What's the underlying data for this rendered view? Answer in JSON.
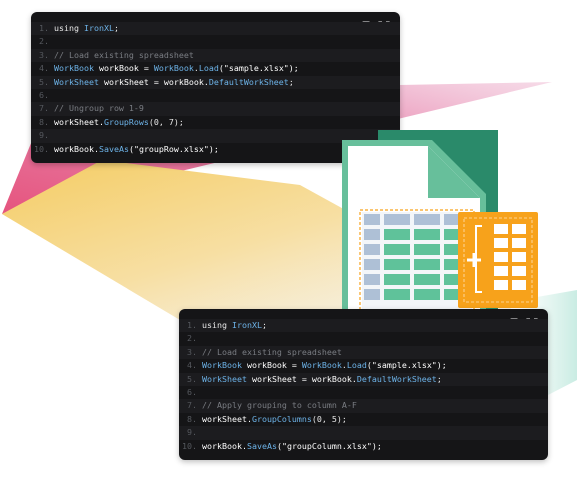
{
  "colors": {
    "pink": "#e5547e",
    "yellow": "#f4cc63",
    "sheet_green": "#5fb896",
    "sheet_dark": "#2a8a6a",
    "grid_blue": "#aec0d6",
    "grid_green": "#5fc29a",
    "orange": "#f7a21b"
  },
  "icons": {
    "copy": "copy-icon",
    "fullscreen": "fullscreen-icon",
    "add": "plus-icon"
  },
  "snippet_top": {
    "lines": [
      {
        "n": "1.",
        "alt": true,
        "tokens": [
          {
            "t": "using ",
            "c": "kw"
          },
          {
            "t": "IronXL",
            "c": "type"
          },
          {
            "t": ";",
            "c": "kw"
          }
        ]
      },
      {
        "n": "2.",
        "alt": false,
        "tokens": []
      },
      {
        "n": "3.",
        "alt": true,
        "tokens": [
          {
            "t": "// Load existing spreadsheet",
            "c": "com"
          }
        ]
      },
      {
        "n": "4.",
        "alt": false,
        "tokens": [
          {
            "t": "WorkBook",
            "c": "type"
          },
          {
            "t": " workBook = ",
            "c": "id"
          },
          {
            "t": "WorkBook",
            "c": "type"
          },
          {
            "t": ".",
            "c": "kw"
          },
          {
            "t": "Load",
            "c": "type"
          },
          {
            "t": "(\"sample.xlsx\");",
            "c": "str"
          }
        ]
      },
      {
        "n": "5.",
        "alt": true,
        "tokens": [
          {
            "t": "WorkSheet",
            "c": "type"
          },
          {
            "t": " workSheet = workBook.",
            "c": "id"
          },
          {
            "t": "DefaultWorkSheet",
            "c": "type"
          },
          {
            "t": ";",
            "c": "kw"
          }
        ]
      },
      {
        "n": "6.",
        "alt": false,
        "tokens": []
      },
      {
        "n": "7.",
        "alt": true,
        "tokens": [
          {
            "t": "// Ungroup row 1-9",
            "c": "com"
          }
        ]
      },
      {
        "n": "8.",
        "alt": false,
        "tokens": [
          {
            "t": "workSheet.",
            "c": "id"
          },
          {
            "t": "GroupRows",
            "c": "type"
          },
          {
            "t": "(0, 7);",
            "c": "num"
          }
        ]
      },
      {
        "n": "9.",
        "alt": true,
        "tokens": []
      },
      {
        "n": "10.",
        "alt": false,
        "tokens": [
          {
            "t": "workBook.",
            "c": "id"
          },
          {
            "t": "SaveAs",
            "c": "type"
          },
          {
            "t": "(\"groupRow.xlsx\");",
            "c": "str"
          }
        ]
      }
    ]
  },
  "snippet_bottom": {
    "lines": [
      {
        "n": "1.",
        "alt": true,
        "tokens": [
          {
            "t": "using ",
            "c": "kw"
          },
          {
            "t": "IronXL",
            "c": "type"
          },
          {
            "t": ";",
            "c": "kw"
          }
        ]
      },
      {
        "n": "2.",
        "alt": false,
        "tokens": []
      },
      {
        "n": "3.",
        "alt": true,
        "tokens": [
          {
            "t": "// Load existing spreadsheet",
            "c": "com"
          }
        ]
      },
      {
        "n": "4.",
        "alt": false,
        "tokens": [
          {
            "t": "WorkBook",
            "c": "type"
          },
          {
            "t": " workBook = ",
            "c": "id"
          },
          {
            "t": "WorkBook",
            "c": "type"
          },
          {
            "t": ".",
            "c": "kw"
          },
          {
            "t": "Load",
            "c": "type"
          },
          {
            "t": "(\"sample.xlsx\");",
            "c": "str"
          }
        ]
      },
      {
        "n": "5.",
        "alt": true,
        "tokens": [
          {
            "t": "WorkSheet",
            "c": "type"
          },
          {
            "t": " workSheet = workBook.",
            "c": "id"
          },
          {
            "t": "DefaultWorkSheet",
            "c": "type"
          },
          {
            "t": ";",
            "c": "kw"
          }
        ]
      },
      {
        "n": "6.",
        "alt": false,
        "tokens": []
      },
      {
        "n": "7.",
        "alt": true,
        "tokens": [
          {
            "t": "// Apply grouping to column A-F",
            "c": "com"
          }
        ]
      },
      {
        "n": "8.",
        "alt": false,
        "tokens": [
          {
            "t": "workSheet.",
            "c": "id"
          },
          {
            "t": "GroupColumns",
            "c": "type"
          },
          {
            "t": "(0, 5);",
            "c": "num"
          }
        ]
      },
      {
        "n": "9.",
        "alt": true,
        "tokens": []
      },
      {
        "n": "10.",
        "alt": false,
        "tokens": [
          {
            "t": "workBook.",
            "c": "id"
          },
          {
            "t": "SaveAs",
            "c": "type"
          },
          {
            "t": "(\"groupColumn.xlsx\");",
            "c": "str"
          }
        ]
      }
    ]
  }
}
